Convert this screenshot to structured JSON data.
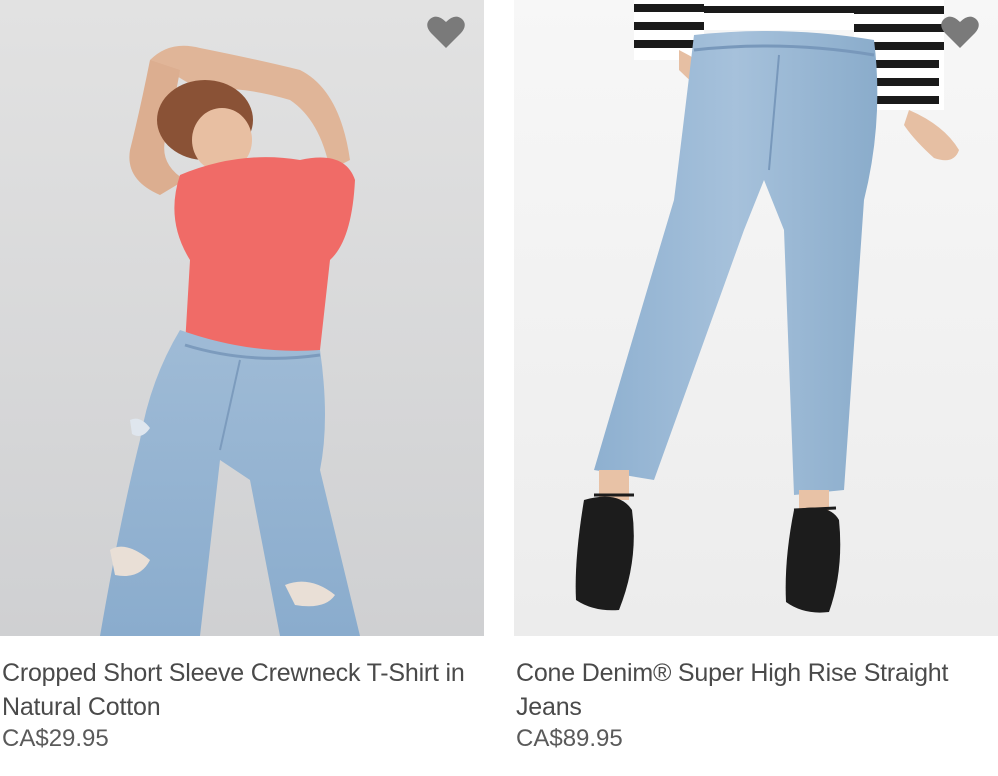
{
  "products": [
    {
      "title": "Cropped Short Sleeve Crewneck T-Shirt in Natural Cotton",
      "price": "CA$29.95",
      "favorite_icon": "heart-icon",
      "image": "model in coral t-shirt and ripped light-wash jeans"
    },
    {
      "title": "Cone Denim® Super High Rise Straight Jeans",
      "price": "CA$89.95",
      "favorite_icon": "heart-icon",
      "image": "model in striped top, light-wash straight jeans and black heels"
    }
  ],
  "colors": {
    "text": "#4a4a4a",
    "heart": "#7a7a7a",
    "photo_bg_left": "#dcdcdc",
    "photo_bg_right": "#f4f4f4",
    "denim": "#8fb0cf",
    "tshirt": "#f06b67"
  }
}
